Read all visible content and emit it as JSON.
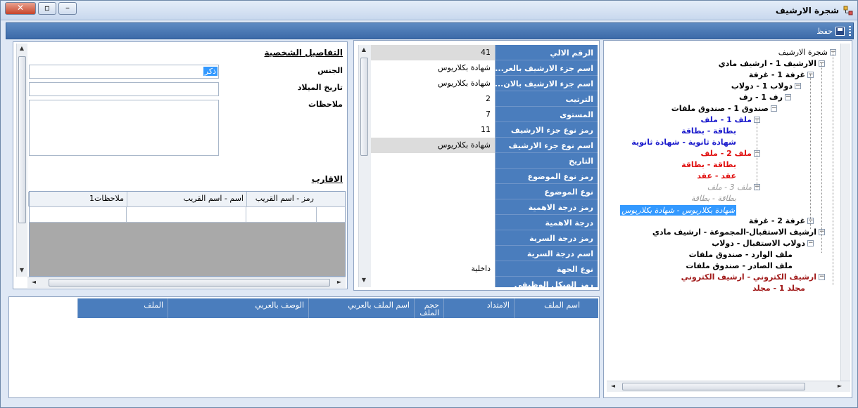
{
  "window": {
    "title": "شجرة الارشيف"
  },
  "toolbar": {
    "save_label": "حفظ"
  },
  "personal": {
    "section_title": "التفاصيل الشخصية",
    "gender_label": "الجنس",
    "gender_value": "ذكر",
    "birthdate_label": "تاريخ الميلاد",
    "birthdate_value": "",
    "notes_label": "ملاحظات",
    "notes_value": ""
  },
  "relatives": {
    "section_title": "الاقارب",
    "columns": [
      "رمز - اسم القريب",
      "اسم - اسم القريب",
      "ملاحظات1"
    ]
  },
  "properties": {
    "rows": [
      {
        "name": "الرقم الالي",
        "value": "41",
        "gray": true
      },
      {
        "name": "اسم جزء الارشيف بالعر...",
        "value": "شهادة بكلاريوس",
        "gray": false
      },
      {
        "name": "اسم جزء الارشيف بالان...",
        "value": "شهادة بكلاريوس",
        "gray": false
      },
      {
        "name": "الترتيب",
        "value": "2",
        "gray": false
      },
      {
        "name": "المستوى",
        "value": "7",
        "gray": false
      },
      {
        "name": "رمز نوع جزء الارشيف",
        "value": "11",
        "gray": false
      },
      {
        "name": "اسم نوع جزء الارشيف",
        "value": "شهادة بكلاريوس",
        "gray": true
      },
      {
        "name": "التاريخ",
        "value": "",
        "gray": false
      },
      {
        "name": "رمز نوع الموضوع",
        "value": "",
        "gray": false
      },
      {
        "name": "نوع الموضوع",
        "value": "",
        "gray": false
      },
      {
        "name": "رمز درجة الاهمية",
        "value": "",
        "gray": false
      },
      {
        "name": "درجة الاهمية",
        "value": "",
        "gray": false
      },
      {
        "name": "رمز درجة السرية",
        "value": "",
        "gray": false
      },
      {
        "name": "اسم درجة السرية",
        "value": "",
        "gray": false
      },
      {
        "name": "نوع الجهة",
        "value": "داخلية",
        "gray": false
      },
      {
        "name": "رمز الهيكل الوظيفي",
        "value": "",
        "gray": false
      }
    ]
  },
  "files": {
    "columns": [
      "اسم الملف",
      "الامتداد",
      "حجم الملف",
      "اسم الملف بالعربي",
      "الوصف بالعربي",
      "الملف"
    ]
  },
  "tree": {
    "nodes": [
      {
        "text": "شجرة الارشيف",
        "color": "#000000",
        "bold": false,
        "italic": false
      },
      {
        "text": "الارشيف 1 - ارشيف مادي",
        "color": "#000000",
        "bold": true,
        "italic": false
      },
      {
        "text": "غرفة 1 - غرفة",
        "color": "#000000",
        "bold": true,
        "italic": false
      },
      {
        "text": "دولاب 1 - دولاب",
        "color": "#000000",
        "bold": true,
        "italic": false
      },
      {
        "text": "رف 1 - رف",
        "color": "#000000",
        "bold": true,
        "italic": false
      },
      {
        "text": "صندوق 1 - صندوق ملفات",
        "color": "#000000",
        "bold": true,
        "italic": false
      },
      {
        "text": "ملف 1 - ملف",
        "color": "#1a1acc",
        "bold": true,
        "italic": false
      },
      {
        "text": "بطاقة - بطاقة",
        "color": "#1a1acc",
        "bold": true,
        "italic": false
      },
      {
        "text": "شهادة ثانوية - شهادة ثانوية",
        "color": "#1a1acc",
        "bold": true,
        "italic": false
      },
      {
        "text": "ملف 2 - ملف",
        "color": "#e01010",
        "bold": true,
        "italic": false
      },
      {
        "text": "بطاقة - بطاقة",
        "color": "#e01010",
        "bold": true,
        "italic": false
      },
      {
        "text": "عقد - عقد",
        "color": "#e01010",
        "bold": true,
        "italic": false
      },
      {
        "text": "ملف 3 - ملف",
        "color": "#9a9a9a",
        "bold": false,
        "italic": true
      },
      {
        "text": "بطاقة - بطاقة",
        "color": "#9a9a9a",
        "bold": false,
        "italic": true
      },
      {
        "text": "شهادة بكلاريوس - شهادة بكلاريوس",
        "color": "#ffffff",
        "bold": false,
        "italic": true
      },
      {
        "text": "غرفة 2 - غرفة",
        "color": "#000000",
        "bold": true,
        "italic": false
      },
      {
        "text": "ارشيف الاستقبال-المجموعة - ارشيف مادي",
        "color": "#000000",
        "bold": true,
        "italic": false
      },
      {
        "text": "دولاب الاستقبال - دولاب",
        "color": "#000000",
        "bold": true,
        "italic": false
      },
      {
        "text": "ملف الوارد - صندوق ملفات",
        "color": "#000000",
        "bold": true,
        "italic": false
      },
      {
        "text": "ملف الصادر - صندوق ملفات",
        "color": "#000000",
        "bold": true,
        "italic": false
      },
      {
        "text": "ارشيف الكتروني - ارشيف الكتروني",
        "color": "#a01818",
        "bold": true,
        "italic": false
      },
      {
        "text": "مجلد 1 - مجلد",
        "color": "#a01818",
        "bold": true,
        "italic": false
      }
    ]
  }
}
